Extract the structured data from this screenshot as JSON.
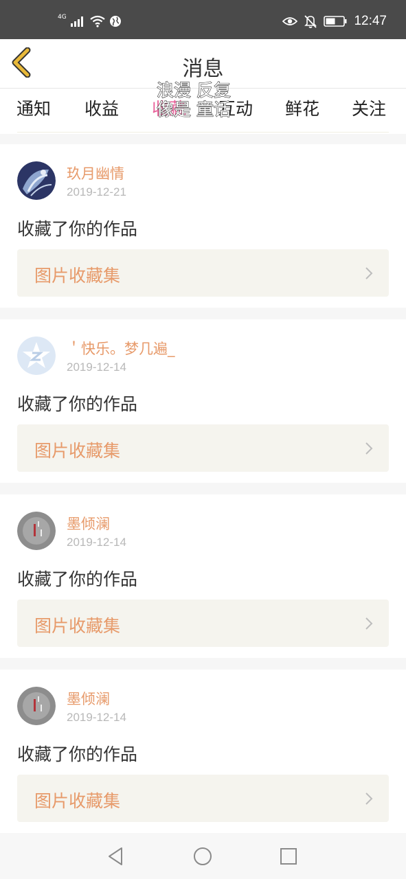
{
  "status_bar": {
    "network": "4G",
    "time": "12:47"
  },
  "header": {
    "title": "消息",
    "back_icon": "chevron-left-icon",
    "accent_color": "#e8b93a"
  },
  "tabs": [
    {
      "label": "通知",
      "active": false
    },
    {
      "label": "收益",
      "active": false
    },
    {
      "label": "收藏",
      "active": true
    },
    {
      "label": "互动",
      "active": false
    },
    {
      "label": "鲜花",
      "active": false
    },
    {
      "label": "关注",
      "active": false
    }
  ],
  "overlay_lyric": {
    "line1": "浪漫 反复",
    "line2": "像是 童话"
  },
  "notifications": [
    {
      "username": "玖月幽情",
      "date": "2019-12-21",
      "action": "收藏了你的作品",
      "collection": "图片收藏集"
    },
    {
      "username": "＇快乐。梦几遍_",
      "date": "2019-12-14",
      "action": "收藏了你的作品",
      "collection": "图片收藏集"
    },
    {
      "username": "墨倾澜",
      "date": "2019-12-14",
      "action": "收藏了你的作品",
      "collection": "图片收藏集"
    },
    {
      "username": "墨倾澜",
      "date": "2019-12-14",
      "action": "收藏了你的作品",
      "collection": "图片收藏集"
    }
  ],
  "colors": {
    "active_tab": "#e8629a",
    "username": "#e79a6a",
    "collection_bg": "#f5f4ee"
  },
  "nav": [
    "back-triangle-icon",
    "home-circle-icon",
    "recents-square-icon"
  ]
}
